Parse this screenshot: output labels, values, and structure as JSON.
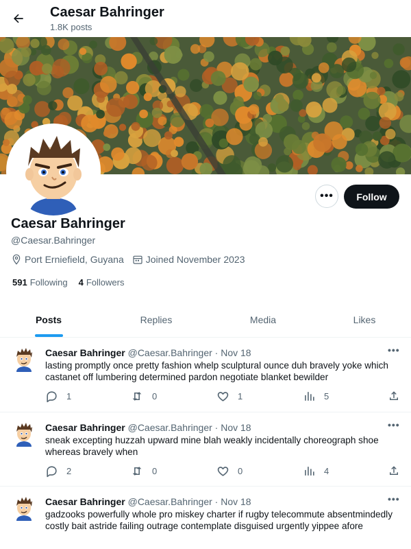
{
  "header": {
    "title": "Caesar Bahringer",
    "subtitle": "1.8K posts"
  },
  "profile": {
    "name": "Caesar Bahringer",
    "handle": "@Caesar.Bahringer",
    "location": "Port Erniefield, Guyana",
    "joined": "Joined November 2023",
    "following_count": "591",
    "following_label": "Following",
    "followers_count": "4",
    "followers_label": "Followers",
    "more_label": "•••",
    "follow_label": "Follow"
  },
  "tabs": [
    {
      "label": "Posts",
      "active": true
    },
    {
      "label": "Replies",
      "active": false
    },
    {
      "label": "Media",
      "active": false
    },
    {
      "label": "Likes",
      "active": false
    }
  ],
  "posts": [
    {
      "name": "Caesar Bahringer",
      "handle": "@Caesar.Bahringer",
      "dot": "·",
      "time": "Nov 18",
      "text": "lasting promptly once pretty fashion whelp sculptural ounce duh bravely yoke which castanet off lumbering determined pardon negotiate blanket bewilder",
      "replies": "1",
      "reposts": "0",
      "likes": "1",
      "views": "5"
    },
    {
      "name": "Caesar Bahringer",
      "handle": "@Caesar.Bahringer",
      "dot": "·",
      "time": "Nov 18",
      "text": "sneak excepting huzzah upward mine blah weakly incidentally choreograph shoe whereas bravely when",
      "replies": "2",
      "reposts": "0",
      "likes": "0",
      "views": "4"
    },
    {
      "name": "Caesar Bahringer",
      "handle": "@Caesar.Bahringer",
      "dot": "·",
      "time": "Nov 18",
      "text": "gadzooks powerfully whole pro miskey charter if rugby telecommute absentmindedly costly bait astride failing outrage contemplate disguised urgently yippee afore",
      "replies": "",
      "reposts": "",
      "likes": "",
      "views": ""
    }
  ],
  "post_more_label": "•••",
  "colors": {
    "accent": "#1d9bf0",
    "text": "#0f1419",
    "muted": "#536471",
    "follow_bg": "#0f1419"
  }
}
